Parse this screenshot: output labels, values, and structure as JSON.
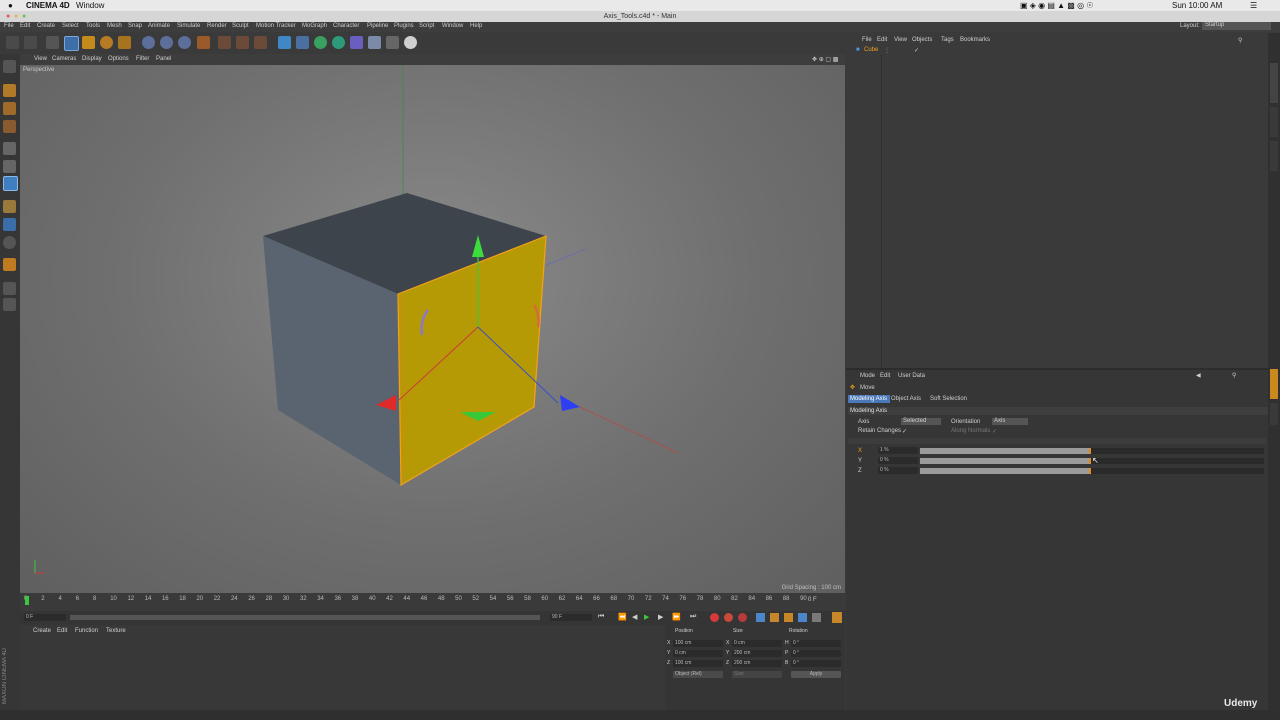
{
  "macbar": {
    "app": "CINEMA 4D",
    "menu": "Window",
    "clock": "Sun 10:00 AM"
  },
  "window_title": "Axis_Tools.c4d * - Main",
  "menubar": [
    "File",
    "Edit",
    "Create",
    "Select",
    "Tools",
    "Mesh",
    "Snap",
    "Animate",
    "Simulate",
    "Render",
    "Sculpt",
    "Motion Tracker",
    "MoGraph",
    "Character",
    "Pipeline",
    "Plugins",
    "Script",
    "Window",
    "Help"
  ],
  "layout": {
    "label": "Layout:",
    "value": "Startup"
  },
  "viewport": {
    "menu": [
      "View",
      "Cameras",
      "Display",
      "Options",
      "Filter",
      "Panel"
    ],
    "camera_label": "Perspective",
    "grid_spacing": "Grid Spacing : 100 cm"
  },
  "timeline": {
    "ticks": [
      "0",
      "2",
      "4",
      "6",
      "8",
      "10",
      "12",
      "14",
      "16",
      "18",
      "20",
      "22",
      "24",
      "26",
      "28",
      "30",
      "32",
      "34",
      "36",
      "38",
      "40",
      "42",
      "44",
      "46",
      "48",
      "50",
      "52",
      "54",
      "56",
      "58",
      "60",
      "62",
      "64",
      "66",
      "68",
      "70",
      "72",
      "74",
      "76",
      "78",
      "80",
      "82",
      "84",
      "86",
      "88",
      "90"
    ],
    "end_label": "0 F",
    "start_field": "0 F",
    "end_field": "90 F"
  },
  "material": {
    "menu": [
      "Create",
      "Edit",
      "Function",
      "Texture"
    ]
  },
  "coords": {
    "headers": [
      "Position",
      "Size",
      "Rotation"
    ],
    "rows": [
      {
        "axis": "X",
        "pos": "100 cm",
        "size_axis": "X",
        "size": "0 cm",
        "rot_axis": "H",
        "rot": "0 °"
      },
      {
        "axis": "Y",
        "pos": "0 cm",
        "size_axis": "Y",
        "size": "200 cm",
        "rot_axis": "P",
        "rot": "0 °"
      },
      {
        "axis": "Z",
        "pos": "100 cm",
        "size_axis": "Z",
        "size": "200 cm",
        "rot_axis": "B",
        "rot": "0 °"
      }
    ],
    "mode": "Object (Rel)",
    "size_mode": "Size",
    "apply": "Apply"
  },
  "objects": {
    "menu": [
      "File",
      "Edit",
      "View",
      "Objects",
      "Tags",
      "Bookmarks"
    ],
    "items": [
      {
        "name": "Cube"
      }
    ]
  },
  "attributes": {
    "menu": [
      "Mode",
      "Edit",
      "User Data"
    ],
    "tool": "Move",
    "tabs": [
      "Modeling Axis",
      "Object Axis",
      "Soft Selection"
    ],
    "section": "Modeling Axis",
    "axis_label": "Axis",
    "axis_value": "Selected",
    "orientation_label": "Orientation",
    "orientation_value": "Axis",
    "retain_label": "Retain Changes",
    "along_normals_label": "Along Normals",
    "sliders": [
      {
        "axis": "X",
        "value": "1 %",
        "fraction": 0.49
      },
      {
        "axis": "Y",
        "value": "0 %",
        "fraction": 0.49
      },
      {
        "axis": "Z",
        "value": "0 %",
        "fraction": 0.49
      }
    ]
  },
  "watermark": "Udemy",
  "brand": "MAXON CINEMA 4D"
}
